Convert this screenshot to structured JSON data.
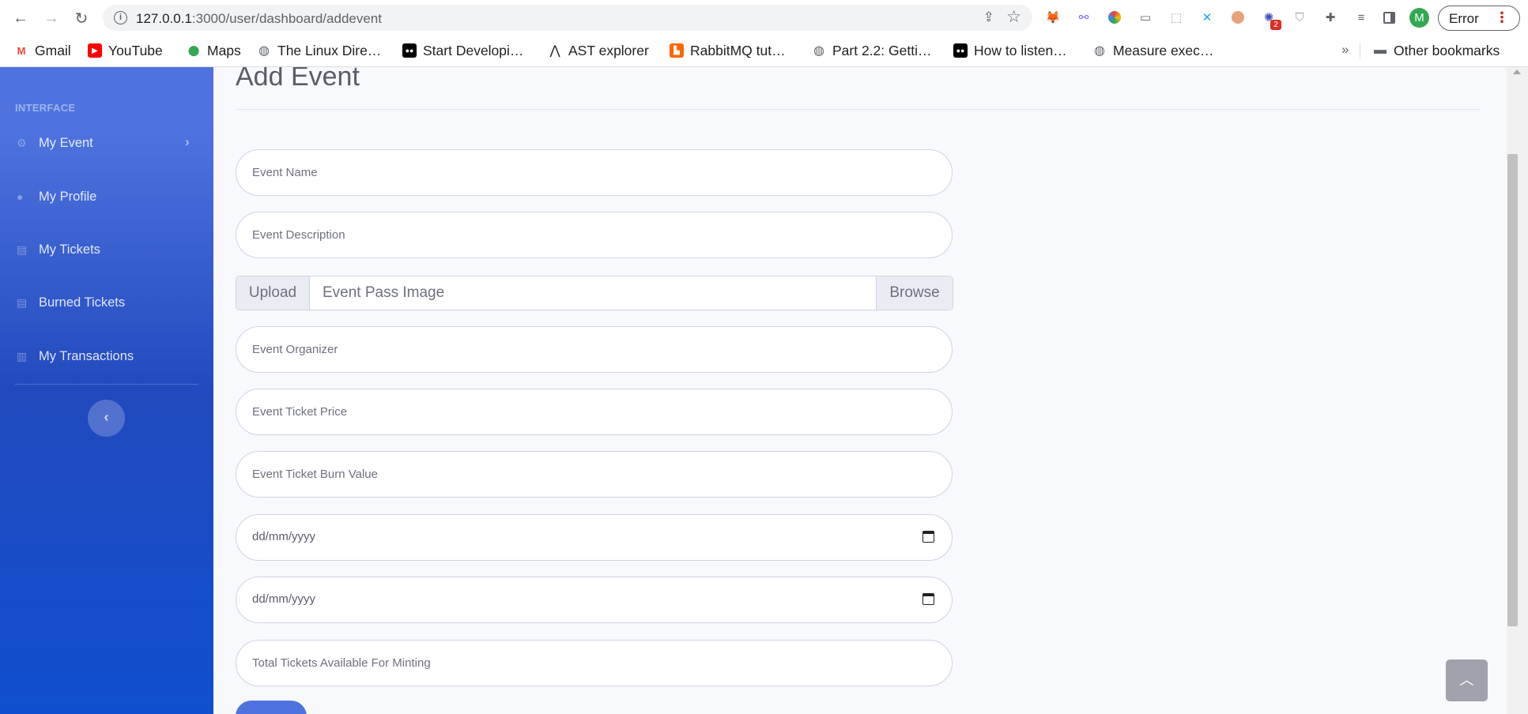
{
  "browser": {
    "url_host": "127.0.0.1",
    "url_rest": ":3000/user/dashboard/addevent",
    "profile_initial": "M",
    "error_label": "Error",
    "extension_badge": "2",
    "bookmarks": [
      {
        "label": "Gmail",
        "icon": "gmail-icon"
      },
      {
        "label": "YouTube",
        "icon": "youtube-icon"
      },
      {
        "label": "Maps",
        "icon": "maps-icon"
      },
      {
        "label": "The Linux Dire…",
        "icon": "globe-icon"
      },
      {
        "label": "Start Developi…",
        "icon": "medium-icon"
      },
      {
        "label": "AST explorer",
        "icon": "ast-icon"
      },
      {
        "label": "RabbitMQ tut…",
        "icon": "rabbitmq-icon"
      },
      {
        "label": "Part 2.2: Getti…",
        "icon": "globe-icon"
      },
      {
        "label": "How to listen…",
        "icon": "medium-icon"
      },
      {
        "label": "Measure exec…",
        "icon": "globe-icon"
      }
    ],
    "bookmarks_more": "»",
    "other_bookmarks": "Other bookmarks"
  },
  "sidebar": {
    "heading": "INTERFACE",
    "items": [
      {
        "label": "My Event",
        "icon": "gear-icon"
      },
      {
        "label": "My Profile",
        "icon": "user-icon"
      },
      {
        "label": "My Tickets",
        "icon": "ticket-icon"
      },
      {
        "label": "Burned Tickets",
        "icon": "ticket-icon"
      },
      {
        "label": "My Transactions",
        "icon": "receipt-icon"
      }
    ]
  },
  "main": {
    "title": "Add Event",
    "fields": {
      "name_placeholder": "Event Name",
      "description_placeholder": "Event Description",
      "organizer_placeholder": "Event Organizer",
      "price_placeholder": "Event Ticket Price",
      "burn_placeholder": "Event Ticket Burn Value",
      "start_date": "dd/mm/yyyy",
      "end_date": "dd/mm/yyyy",
      "total_placeholder": "Total Tickets Available For Minting"
    },
    "upload": {
      "prepend": "Upload",
      "file_label": "Event Pass Image",
      "browse": "Browse"
    }
  },
  "colors": {
    "sidebar_top": "#4e73df",
    "sidebar_bottom": "#0f4fcf",
    "primary": "#4e73df"
  }
}
